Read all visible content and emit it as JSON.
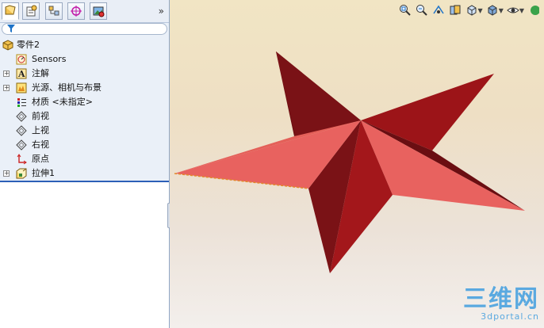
{
  "tabs": [
    {
      "name": "featuremanager",
      "icon": "feature-tree-icon",
      "active": true
    },
    {
      "name": "propertymanager",
      "icon": "property-icon"
    },
    {
      "name": "configurationmanager",
      "icon": "configuration-icon"
    },
    {
      "name": "dimxpert",
      "icon": "target-icon"
    },
    {
      "name": "display",
      "icon": "display-icon"
    }
  ],
  "tab_more": "»",
  "tree": {
    "root_label": "零件2",
    "items": [
      {
        "label": "Sensors",
        "icon": "sensor-icon",
        "expandable": false
      },
      {
        "label": "注解",
        "icon": "annotation-icon",
        "expandable": true
      },
      {
        "label": "光源、相机与布景",
        "icon": "lights-icon",
        "expandable": true
      },
      {
        "label": "材质 <未指定>",
        "icon": "material-icon",
        "expandable": false
      },
      {
        "label": "前视",
        "icon": "plane-icon",
        "expandable": false
      },
      {
        "label": "上视",
        "icon": "plane-icon",
        "expandable": false
      },
      {
        "label": "右视",
        "icon": "plane-icon",
        "expandable": false
      },
      {
        "label": "原点",
        "icon": "origin-icon",
        "expandable": false
      },
      {
        "label": "拉伸1",
        "icon": "extrude-icon",
        "expandable": true
      }
    ]
  },
  "watermark": {
    "main": "三维网",
    "sub": "3dportal.cn"
  },
  "colors": {
    "star_dark": "#6e0f12",
    "star_mid": "#9c1418",
    "star_light": "#e8625f",
    "accent": "#2c5fb7"
  }
}
